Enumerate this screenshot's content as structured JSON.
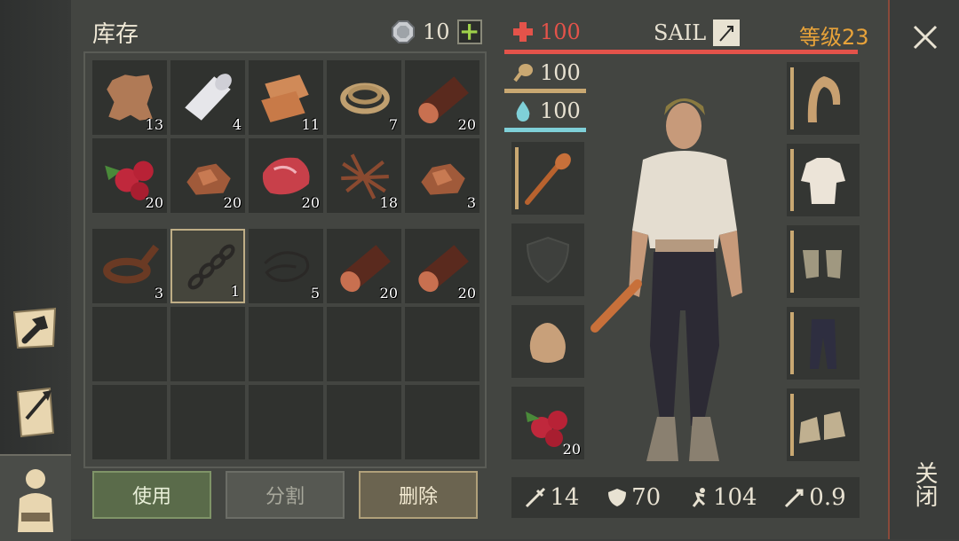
{
  "inventory": {
    "title": "库存",
    "currency": {
      "icon": "coin-icon",
      "value": "10",
      "add_label": "+"
    },
    "rows": [
      [
        {
          "name": "hide",
          "count": "13"
        },
        {
          "name": "cloth-roll",
          "count": "4"
        },
        {
          "name": "fabric-scrap",
          "count": "11"
        },
        {
          "name": "rope",
          "count": "7"
        },
        {
          "name": "log",
          "count": "20"
        }
      ],
      [
        {
          "name": "berries",
          "count": "20"
        },
        {
          "name": "copper-ore",
          "count": "20"
        },
        {
          "name": "raw-meat",
          "count": "20"
        },
        {
          "name": "roots",
          "count": "18"
        },
        {
          "name": "copper-ore",
          "count": "3"
        }
      ],
      [
        {
          "name": "leather-strap",
          "count": "3"
        },
        {
          "name": "chain",
          "count": "1",
          "selected": true
        },
        {
          "name": "wire",
          "count": "5"
        },
        {
          "name": "log",
          "count": "20"
        },
        {
          "name": "log",
          "count": "20"
        }
      ]
    ],
    "buttons": {
      "use": "使用",
      "split": "分割",
      "delete": "删除"
    }
  },
  "character": {
    "health": "100",
    "name": "SAIL",
    "level": "等级23",
    "food": "100",
    "water": "100",
    "weapon_count": "20",
    "stats": {
      "attack": "14",
      "defense": "70",
      "speed": "104",
      "weight": "0.9"
    }
  },
  "close": {
    "label": "关闭"
  },
  "colors": {
    "health": "#e4534a",
    "food": "#c9a872",
    "water": "#7fd0d8",
    "level": "#e8a33a",
    "accent_green": "#9fd14a"
  }
}
